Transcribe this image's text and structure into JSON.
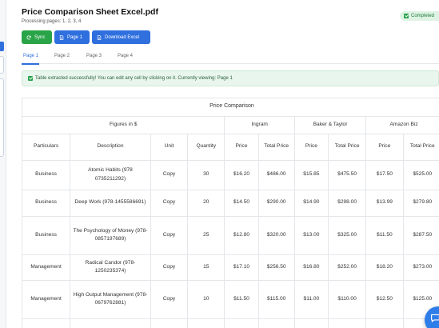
{
  "header": {
    "title": "Price Comparison Sheet Excel.pdf",
    "subtitle": "Processing pages: 1, 2, 3, 4",
    "status": "Completed",
    "status_color": "#23a047"
  },
  "toolbar": {
    "sync_label": "Sync",
    "page_label": "Page 1",
    "download_label": "Download Excel"
  },
  "tabs": [
    {
      "label": "Page 1",
      "active": true
    },
    {
      "label": "Page 2",
      "active": false
    },
    {
      "label": "Page 3",
      "active": false
    },
    {
      "label": "Page 4",
      "active": false
    }
  ],
  "notice": {
    "text": "Table extracted successfully! You can edit any cell by clicking on it.  Currently viewing: Page 1"
  },
  "table": {
    "title": "Price Comparison",
    "groups": {
      "figures": "Figures in $",
      "ingram": "Ingram",
      "baker": "Baker & Taylor",
      "amazon": "Amazon Biz"
    },
    "columns": [
      "Particulars",
      "Description",
      "Unit",
      "Quantity",
      "Price",
      "Total Price",
      "Price",
      "Total Price",
      "Price",
      "Total Price"
    ],
    "rows": [
      [
        "Business",
        "Atomic Habits (978 0735211292)",
        "Copy",
        "30",
        "$16.20",
        "$486.00",
        "$15.85",
        "$475.50",
        "$17.50",
        "$525.00"
      ],
      [
        "Business",
        "Deep Work (978-1455586691)",
        "Copy",
        "20",
        "$14.50",
        "$290.00",
        "$14.90",
        "$298.00",
        "$13.99",
        "$279.80"
      ],
      [
        "Business",
        "The Psychology of Money (978-0857197689)",
        "Copy",
        "25",
        "$12.80",
        "$320.00",
        "$13.00",
        "$325.00",
        "$11.50",
        "$287.50"
      ],
      [
        "Management",
        "Radical Candor (978-1250235374)",
        "Copy",
        "15",
        "$17.10",
        "$256.50",
        "$16.80",
        "$252.00",
        "$18.20",
        "$273.00"
      ],
      [
        "Management",
        "High Output Management (978-0679762881)",
        "Copy",
        "10",
        "$11.50",
        "$115.00",
        "$11.00",
        "$110.00",
        "$12.50",
        "$125.00"
      ],
      [
        "",
        "",
        "",
        "",
        "",
        "",
        "",
        "",
        "",
        ""
      ]
    ]
  },
  "icons": {
    "sync": "sync-icon",
    "page": "document-icon",
    "download": "document-icon",
    "chat": "chat-icon"
  },
  "colors": {
    "accent": "#2f6fde",
    "success": "#2aa448"
  }
}
